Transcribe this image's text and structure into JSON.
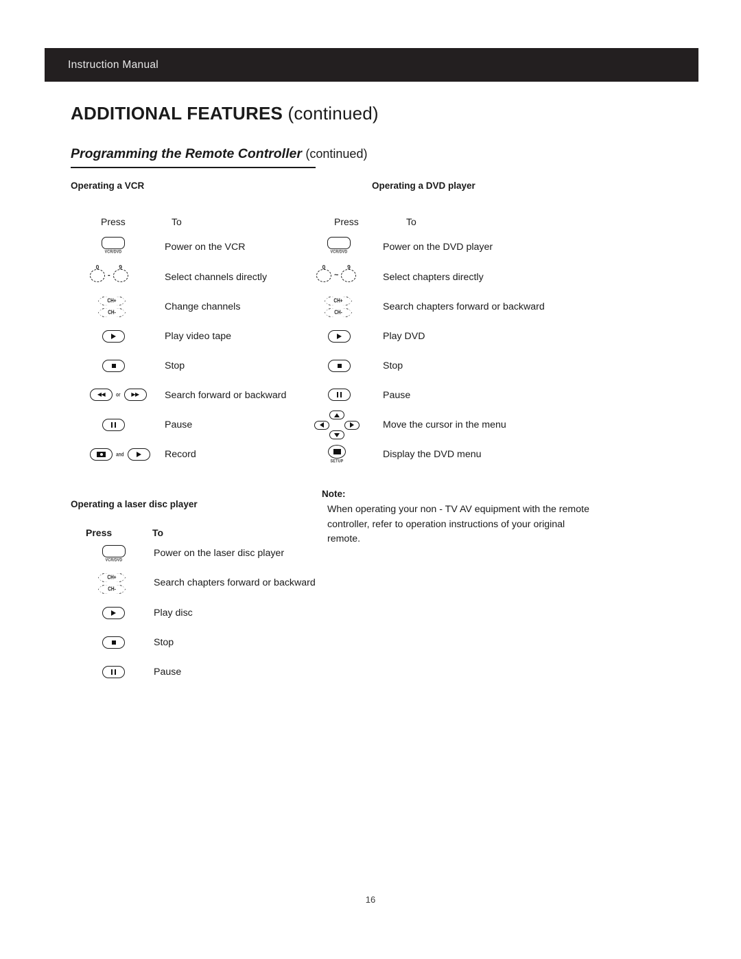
{
  "header": {
    "label": "Instruction Manual"
  },
  "titles": {
    "main": "ADDITIONAL FEATURES",
    "main_continued": "(continued)",
    "sub": "Programming the Remote Controller",
    "sub_continued": "(continued)"
  },
  "sections": {
    "vcr": {
      "heading": "Operating a VCR",
      "col_press": "Press",
      "col_to": "To",
      "rows": [
        {
          "icon": "power-vcr-dvd-button-icon",
          "caption": "VCR/DVD",
          "to": "Power on the VCR"
        },
        {
          "icon": "number-buttons-0-to-9-icon",
          "caption": "0 - 9",
          "to": "Select channels directly"
        },
        {
          "icon": "channel-up-down-rocker-icon",
          "caption": "CH+ / CH-",
          "to": "Change channels"
        },
        {
          "icon": "play-button-icon",
          "caption": "PLAY",
          "to": "Play video tape"
        },
        {
          "icon": "stop-button-icon",
          "caption": "STOP",
          "to": "Stop"
        },
        {
          "icon": "rewind-or-fast-forward-buttons-icon",
          "caption": "or",
          "to": "Search forward or backward"
        },
        {
          "icon": "pause-button-icon",
          "caption": "PAUSE",
          "to": "Pause"
        },
        {
          "icon": "record-and-play-buttons-icon",
          "caption": "and",
          "to": "Record"
        }
      ]
    },
    "dvd": {
      "heading": "Operating a DVD player",
      "col_press": "Press",
      "col_to": "To",
      "rows": [
        {
          "icon": "power-vcr-dvd-button-icon",
          "caption": "VCR/DVD",
          "to": "Power on the DVD player"
        },
        {
          "icon": "number-buttons-0-to-9-icon",
          "caption": "0 - 9",
          "to": "Select chapters directly"
        },
        {
          "icon": "chapter-search-rocker-icon",
          "caption": "CH+ / CH-",
          "to": "Search chapters forward or backward"
        },
        {
          "icon": "play-button-icon",
          "caption": "PLAY",
          "to": "Play DVD"
        },
        {
          "icon": "stop-button-icon",
          "caption": "STOP",
          "to": "Stop"
        },
        {
          "icon": "pause-button-icon",
          "caption": "PAUSE",
          "to": "Pause"
        },
        {
          "icon": "cursor-direction-pad-icon",
          "caption": "",
          "to": "Move the cursor in the menu"
        },
        {
          "icon": "setup-menu-button-icon",
          "caption": "SETUP",
          "to": "Display the DVD menu"
        }
      ]
    },
    "laser": {
      "heading": "Operating a laser disc player",
      "col_press": "Press",
      "col_to": "To",
      "rows": [
        {
          "icon": "power-vcr-dvd-button-icon",
          "caption": "VCR/DVD",
          "to": "Power on the laser disc player"
        },
        {
          "icon": "chapter-search-rocker-icon",
          "caption": "CH+ / CH-",
          "to": "Search chapters forward or backward"
        },
        {
          "icon": "play-button-icon",
          "caption": "PLAY",
          "to": "Play disc"
        },
        {
          "icon": "stop-button-icon",
          "caption": "STOP",
          "to": "Stop"
        },
        {
          "icon": "pause-button-icon",
          "caption": "PAUSE",
          "to": "Pause"
        }
      ]
    }
  },
  "note": {
    "title": "Note:",
    "body": "When operating your non - TV AV equipment with the remote controller, refer to operation instructions of your original remote."
  },
  "icon_labels": {
    "vcr_dvd": "VCR/DVD",
    "setup": "SETUP",
    "num_low": "0",
    "num_high": "9",
    "dash": "-",
    "tilde": "~",
    "ch_plus": "CH+",
    "ch_minus": "CH-",
    "conj_or": "or",
    "conj_and": "and"
  },
  "footer": {
    "page_number": "16"
  },
  "colors": {
    "header_bar": "#231f20",
    "header_text": "#e9e9e9",
    "body_text": "#1a1a1a",
    "page_background": "#ffffff"
  }
}
